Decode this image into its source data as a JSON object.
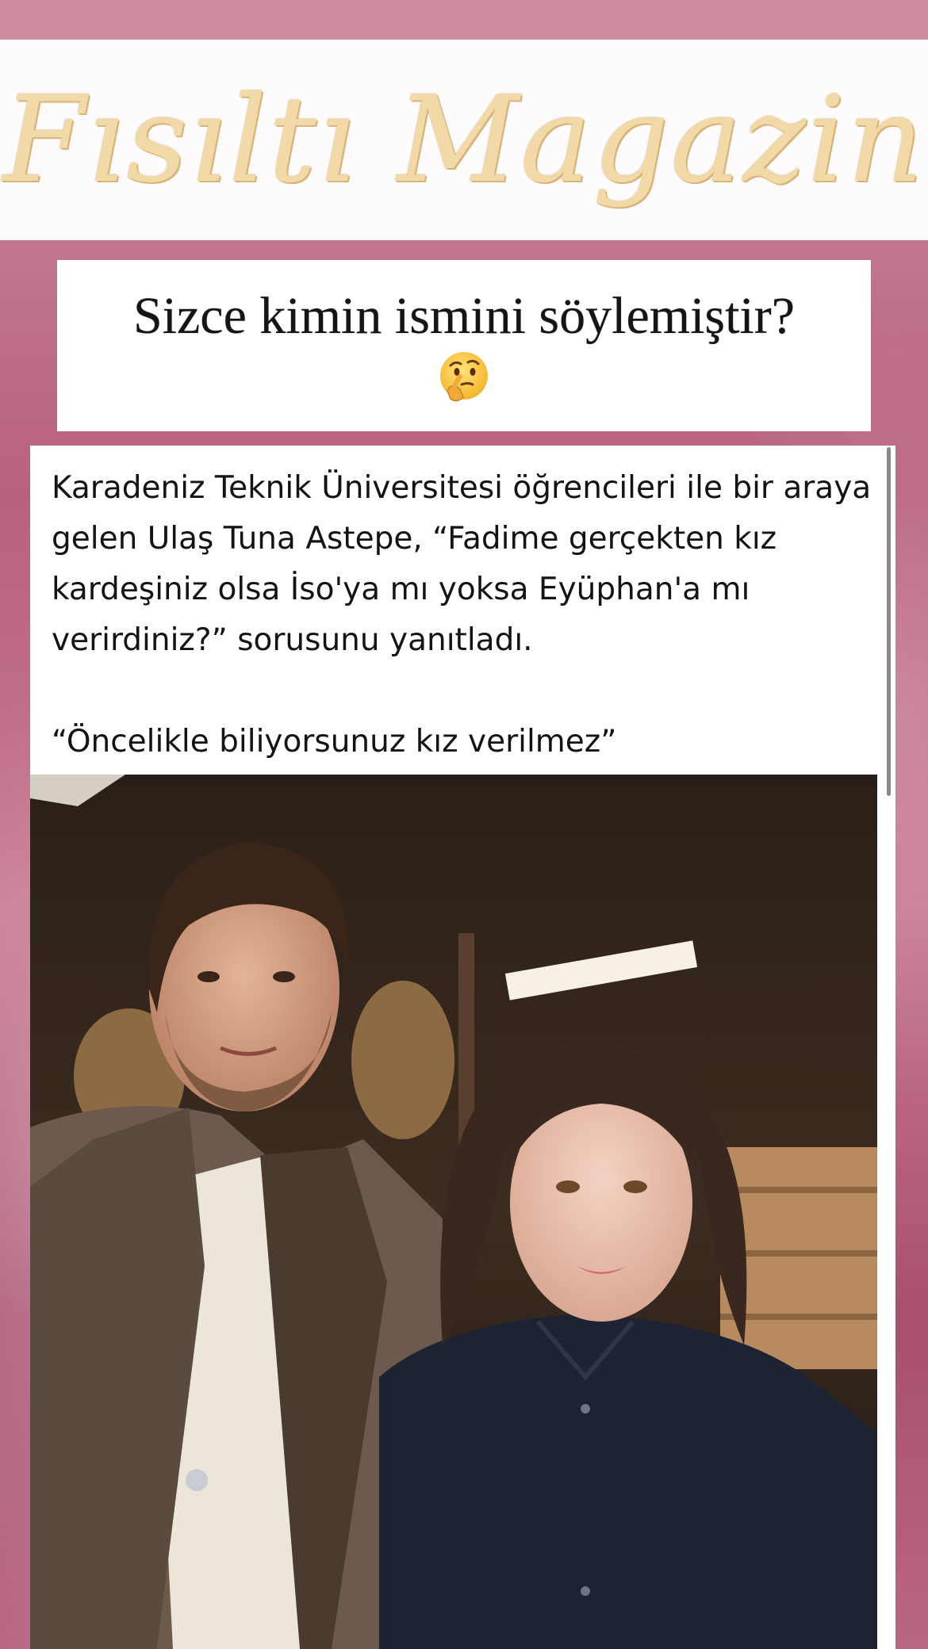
{
  "logo": {
    "text": "Fısıltı Magazin"
  },
  "headline": {
    "text": "Sizce kimin ismini söylemiştir?",
    "emoji_icon": "thinking-face-icon"
  },
  "post": {
    "paragraph": "Karadeniz Teknik Üniversitesi öğrencileri ile bir araya gelen Ulaş Tuna Astepe, “Fadime gerçekten kız kardeşiniz olsa İso'ya mı yoksa Eyüphan'a mı verirdiniz?” sorusunu yanıtladı.\n\n“Öncelikle biliyorsunuz kız verilmez”",
    "photo_alt": "Selfie of a man and a young woman"
  },
  "colors": {
    "background": "#b8617f",
    "logo_gold": "#f2d9a8",
    "headline_text": "#151515"
  }
}
